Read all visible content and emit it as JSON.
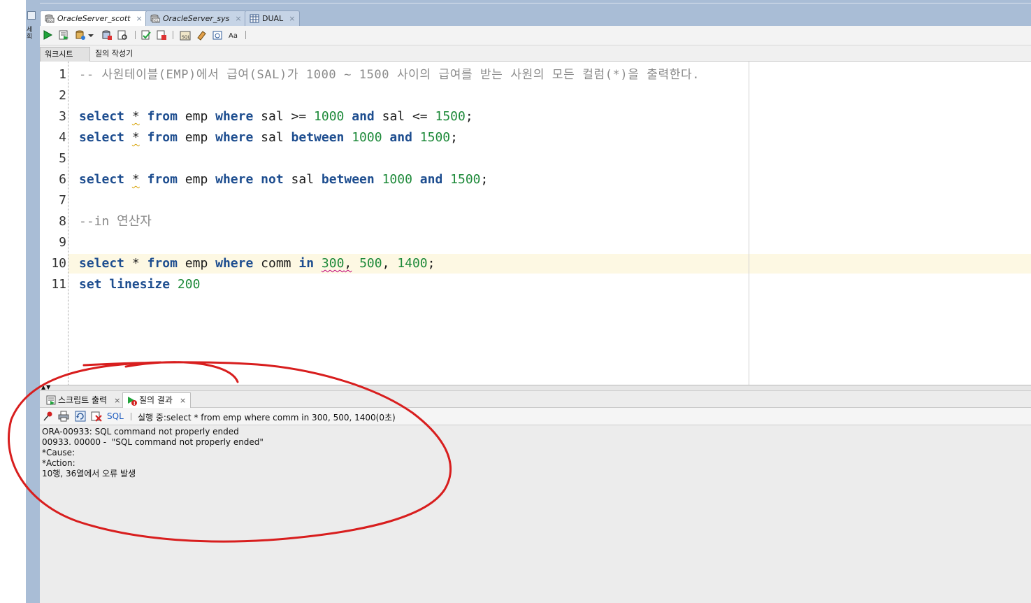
{
  "left_rail": {
    "label": "세\n회"
  },
  "doc_tabs": [
    {
      "label": "OracleServer_scott",
      "close": "×",
      "icon": "sql-connection-icon"
    },
    {
      "label": "OracleServer_sys",
      "close": "×",
      "icon": "sql-connection-icon"
    },
    {
      "label": "DUAL",
      "close": "×",
      "icon": "table-icon"
    }
  ],
  "toolbar": {
    "icons": [
      "run-statement-icon",
      "run-script-icon",
      "commit-icon",
      "dropdown-arrow-icon",
      "rollback-icon",
      "explain-plan-icon",
      "autotrace-icon",
      "clear-icon",
      "sql-history-icon",
      "eraser-icon",
      "format-icon",
      "uppercase-lowercase-icon"
    ]
  },
  "sub_tabs": [
    {
      "label": "워크시트"
    },
    {
      "label": "질의 작성기"
    }
  ],
  "editor": {
    "line_numbers": [
      "1",
      "2",
      "3",
      "4",
      "5",
      "6",
      "7",
      "8",
      "9",
      "10",
      "11"
    ],
    "comment1": "-- 사원테이블(EMP)에서 급여(SAL)가 1000 ~ 1500 사이의 급여를 받는 사원의 모든 컬럼(*)을 출력한다.",
    "comment8": "--in 연산자",
    "tokens": {
      "select": "select",
      "star": "*",
      "from": "from",
      "emp": "emp",
      "where": "where",
      "sal": "sal",
      "ge": ">=",
      "le": "<=",
      "and": "and",
      "between": "between",
      "not": "not",
      "comm": "comm",
      "in": "in",
      "n1000": "1000",
      "n1500": "1500",
      "n300": "300",
      "n500": "500",
      "n1400": "1400",
      "semi": ";",
      "comma": ",",
      "set": "set",
      "linesize": "linesize",
      "n200": "200"
    }
  },
  "bottom_tabs": [
    {
      "label": "스크립트 출력",
      "close": "×",
      "icon": "script-output-icon"
    },
    {
      "label": "질의 결과",
      "close": "×",
      "icon": "query-result-error-icon"
    }
  ],
  "result_toolbar": {
    "sql_link": "SQL",
    "status": "실행 중:select * from emp where comm in 300, 500, 1400(0초)"
  },
  "output_lines": [
    "ORA-00933: SQL command not properly ended",
    "00933. 00000 -  \"SQL command not properly ended\"",
    "*Cause:",
    "*Action:",
    "10행, 36열에서 오류 발생"
  ],
  "colors": {
    "keyword": "#1d4d8f",
    "number": "#1e8a3a",
    "comment": "#8a8a8a",
    "annotation": "#d81e1e",
    "tab_frame": "#a9bdd6"
  }
}
